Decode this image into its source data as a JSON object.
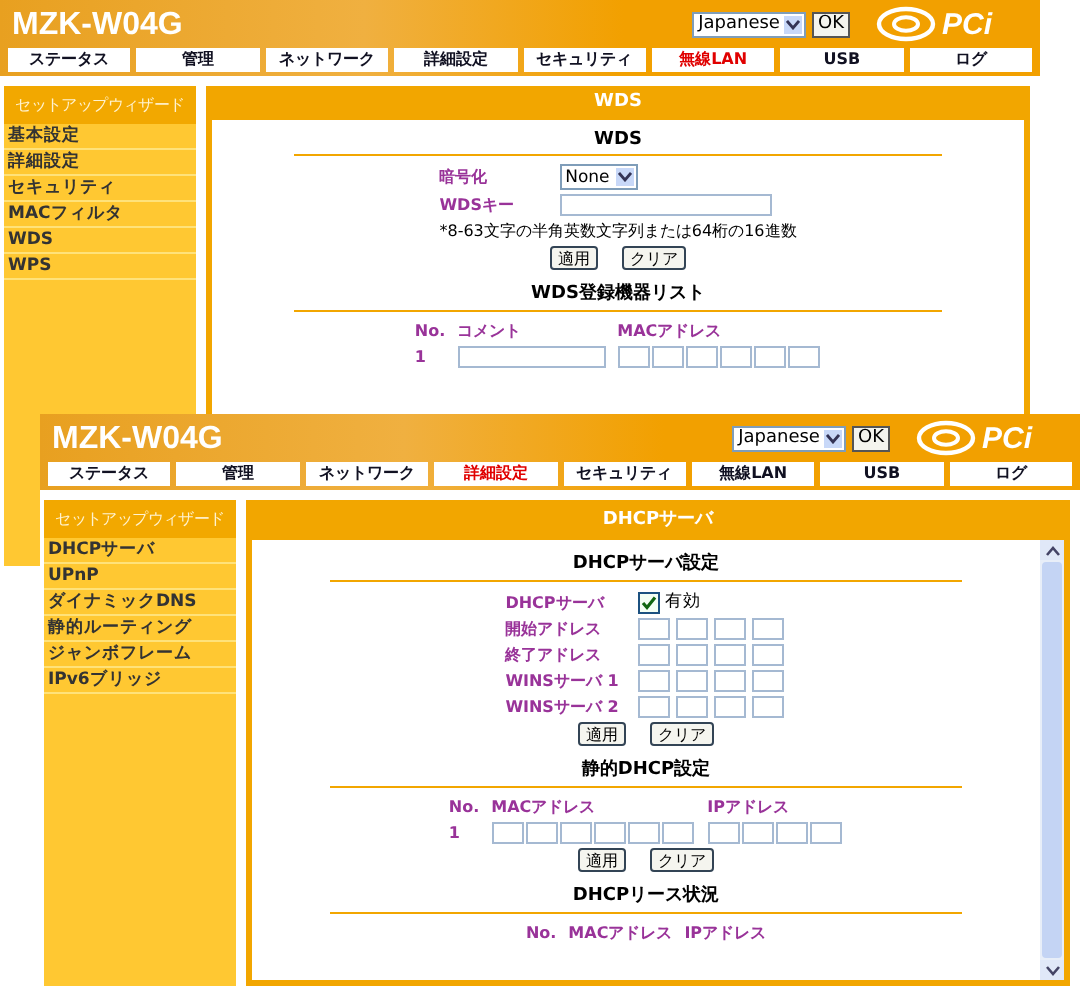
{
  "windows": [
    {
      "title": "MZK-W04G",
      "language": "Japanese",
      "ok": "OK",
      "logo": "PCi",
      "nav": [
        {
          "label": "ステータス",
          "selected": false
        },
        {
          "label": "管理",
          "selected": false
        },
        {
          "label": "ネットワーク",
          "selected": false
        },
        {
          "label": "詳細設定",
          "selected": false
        },
        {
          "label": "セキュリティ",
          "selected": false
        },
        {
          "label": "無線LAN",
          "selected": true
        },
        {
          "label": "USB",
          "selected": false
        },
        {
          "label": "ログ",
          "selected": false
        }
      ],
      "sidebar": {
        "header": "セットアップウィザード",
        "items": [
          "基本設定",
          "詳細設定",
          "セキュリティ",
          "MACフィルタ",
          "WDS",
          "WPS"
        ]
      },
      "panel": {
        "title": "WDS",
        "sections": [
          {
            "heading": "WDS",
            "rows": [
              {
                "kind": "select",
                "label": "暗号化",
                "value": "None"
              },
              {
                "kind": "text",
                "label": "WDSキー"
              },
              {
                "kind": "note",
                "text": "*8-63文字の半角英数文字列または64桁の16進数"
              },
              {
                "kind": "buttons",
                "buttons": [
                  "適用",
                  "クリア"
                ]
              }
            ]
          },
          {
            "heading": "WDS登録機器リスト",
            "rows": [
              {
                "kind": "table",
                "columns": [
                  "No.",
                  "コメント",
                  "MACアドレス"
                ],
                "entries": [
                  {
                    "no": "1",
                    "cells": [
                      {
                        "kind": "text"
                      },
                      {
                        "kind": "mac"
                      }
                    ]
                  }
                ]
              }
            ]
          }
        ]
      }
    },
    {
      "title": "MZK-W04G",
      "language": "Japanese",
      "ok": "OK",
      "logo": "PCi",
      "nav": [
        {
          "label": "ステータス",
          "selected": false
        },
        {
          "label": "管理",
          "selected": false
        },
        {
          "label": "ネットワーク",
          "selected": false
        },
        {
          "label": "詳細設定",
          "selected": true
        },
        {
          "label": "セキュリティ",
          "selected": false
        },
        {
          "label": "無線LAN",
          "selected": false
        },
        {
          "label": "USB",
          "selected": false
        },
        {
          "label": "ログ",
          "selected": false
        }
      ],
      "sidebar": {
        "header": "セットアップウィザード",
        "items": [
          "DHCPサーバ",
          "UPnP",
          "ダイナミックDNS",
          "静的ルーティング",
          "ジャンボフレーム",
          "IPv6ブリッジ"
        ]
      },
      "panel": {
        "title": "DHCPサーバ",
        "scrollbar": true,
        "sections": [
          {
            "heading": "DHCPサーバ設定",
            "rows": [
              {
                "kind": "checkbox",
                "label": "DHCPサーバ",
                "text": "有効",
                "checked": true
              },
              {
                "kind": "ip",
                "label": "開始アドレス"
              },
              {
                "kind": "ip",
                "label": "終了アドレス"
              },
              {
                "kind": "ip",
                "label": "WINSサーバ 1"
              },
              {
                "kind": "ip",
                "label": "WINSサーバ 2"
              },
              {
                "kind": "buttons",
                "buttons": [
                  "適用",
                  "クリア"
                ]
              }
            ]
          },
          {
            "heading": "静的DHCP設定",
            "rows": [
              {
                "kind": "table",
                "columns": [
                  "No.",
                  "MACアドレス",
                  "IPアドレス"
                ],
                "entries": [
                  {
                    "no": "1",
                    "cells": [
                      {
                        "kind": "mac"
                      },
                      {
                        "kind": "ip"
                      }
                    ]
                  }
                ]
              },
              {
                "kind": "buttons",
                "buttons": [
                  "適用",
                  "クリア"
                ]
              }
            ]
          },
          {
            "heading": "DHCPリース状況",
            "rows": [
              {
                "kind": "table",
                "columns": [
                  "No.",
                  "MACアドレス",
                  "IPアドレス"
                ],
                "entries": []
              }
            ]
          }
        ]
      }
    }
  ]
}
